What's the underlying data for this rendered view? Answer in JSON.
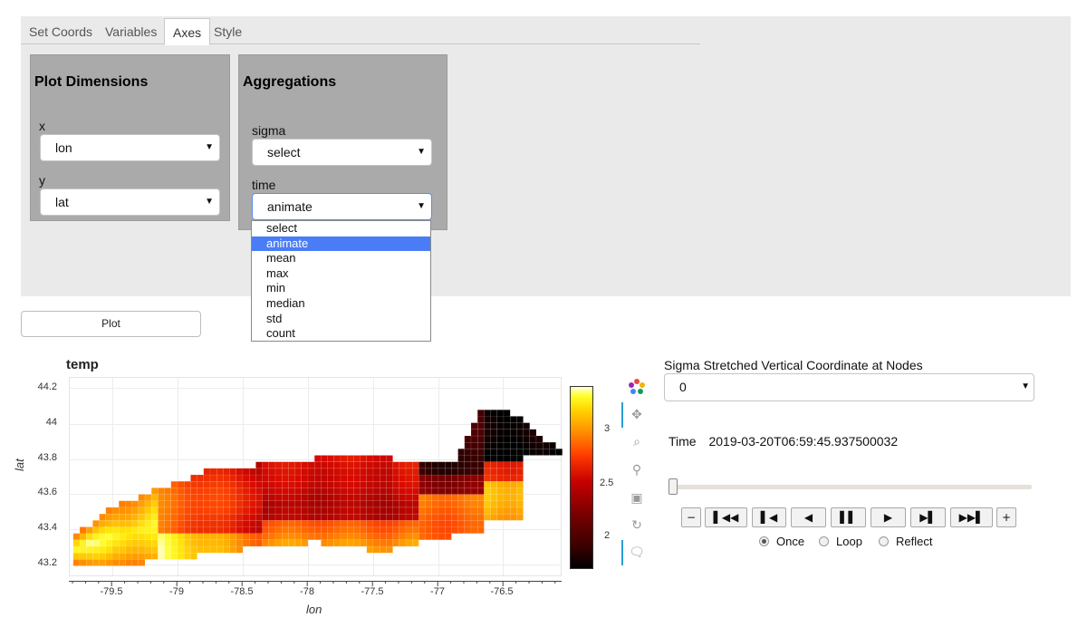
{
  "tabs": [
    "Set Coords",
    "Variables",
    "Axes",
    "Style"
  ],
  "active_tab": "Axes",
  "plot_dimensions": {
    "title": "Plot Dimensions",
    "x_label": "x",
    "x_value": "lon",
    "y_label": "y",
    "y_value": "lat"
  },
  "aggregations": {
    "title": "Aggregations",
    "sigma_label": "sigma",
    "sigma_value": "select",
    "time_label": "time",
    "time_value": "animate",
    "time_options": [
      "select",
      "animate",
      "mean",
      "max",
      "min",
      "median",
      "std",
      "count"
    ],
    "time_highlighted": "animate"
  },
  "plot_button_label": "Plot",
  "plot": {
    "title": "temp",
    "xlabel": "lon",
    "ylabel": "lat",
    "xticks": [
      "-79.5",
      "-79",
      "-78.5",
      "-78",
      "-77.5",
      "-77",
      "-76.5"
    ],
    "yticks": [
      "44.2",
      "44",
      "43.8",
      "43.6",
      "43.4",
      "43.2"
    ],
    "colorbar_ticks": [
      "3",
      "2.5",
      "2"
    ]
  },
  "chart_data": {
    "type": "heatmap",
    "title": "temp",
    "xlabel": "lon",
    "ylabel": "lat",
    "xlim": [
      -79.85,
      -76.1
    ],
    "ylim": [
      43.15,
      44.25
    ],
    "color_range": [
      1.7,
      3.4
    ],
    "colorbar_ticks": [
      3,
      2.5,
      2
    ]
  },
  "widgets": {
    "sigma_title": "Sigma Stretched Vertical Coordinate at Nodes",
    "sigma_value": "0",
    "time_label": "Time",
    "time_value": "2019-03-20T06:59:45.937500032",
    "player_buttons": [
      "−",
      "▌◀◀",
      "▌◀",
      "◀",
      "▌▌",
      "▶",
      "▶▌",
      "▶▶▌",
      "+"
    ],
    "loop_options": [
      "Once",
      "Loop",
      "Reflect"
    ],
    "loop_selected": "Once"
  },
  "toolbar_icons": [
    "bokeh-logo-icon",
    "pan-icon",
    "box-zoom-icon",
    "wheel-zoom-icon",
    "save-icon",
    "reset-icon",
    "hover-icon"
  ]
}
